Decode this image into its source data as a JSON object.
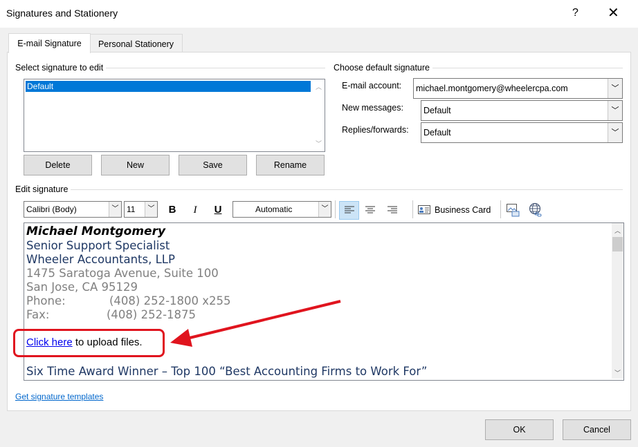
{
  "window": {
    "title": "Signatures and Stationery",
    "help_label": "?",
    "close_label": "✕"
  },
  "tabs": [
    {
      "label": "E-mail Signature",
      "active": true
    },
    {
      "label": "Personal Stationery",
      "active": false
    }
  ],
  "select_section": {
    "label": "Select signature to edit",
    "items": [
      "Default"
    ],
    "selected": "Default"
  },
  "list_buttons": {
    "delete": "Delete",
    "new": "New",
    "save": "Save",
    "rename": "Rename"
  },
  "default_section": {
    "label": "Choose default signature",
    "email_account_label": "E-mail account:",
    "email_account_value": "michael.montgomery@wheelercpa.com",
    "new_messages_label": "New messages:",
    "new_messages_value": "Default",
    "replies_label": "Replies/forwards:",
    "replies_value": "Default"
  },
  "edit_section": {
    "label": "Edit signature",
    "font": "Calibri (Body)",
    "size": "11",
    "bold": "B",
    "italic": "I",
    "underline": "U",
    "color": "Automatic",
    "business_card": "Business Card",
    "icons": [
      "align-left-icon",
      "align-center-icon",
      "align-right-icon",
      "business-card-icon",
      "insert-picture-icon",
      "hyperlink-icon"
    ]
  },
  "signature": {
    "name": "Michael Montgomery",
    "job_title": "Senior Support Specialist",
    "company": "Wheeler Accountants, LLP",
    "address1": "1475 Saratoga Avenue, Suite 100",
    "address2": "San Jose, CA 95129",
    "phone_label": "Phone:",
    "phone": "(408) 252-1800 x255",
    "fax_label": "Fax:",
    "fax": "(408) 252-1875",
    "link_text": "Click here",
    "link_suffix": " to upload files.",
    "award": "Six Time Award Winner – Top 100 “Best Accounting Firms to Work For”"
  },
  "footer": {
    "templates_link": "Get signature templates",
    "ok": "OK",
    "cancel": "Cancel"
  },
  "colors": {
    "selection": "#0078d7",
    "name_color": "#000000",
    "title_color": "#1f3864",
    "gray_text": "#808080",
    "annotation_red": "#e0141e"
  }
}
